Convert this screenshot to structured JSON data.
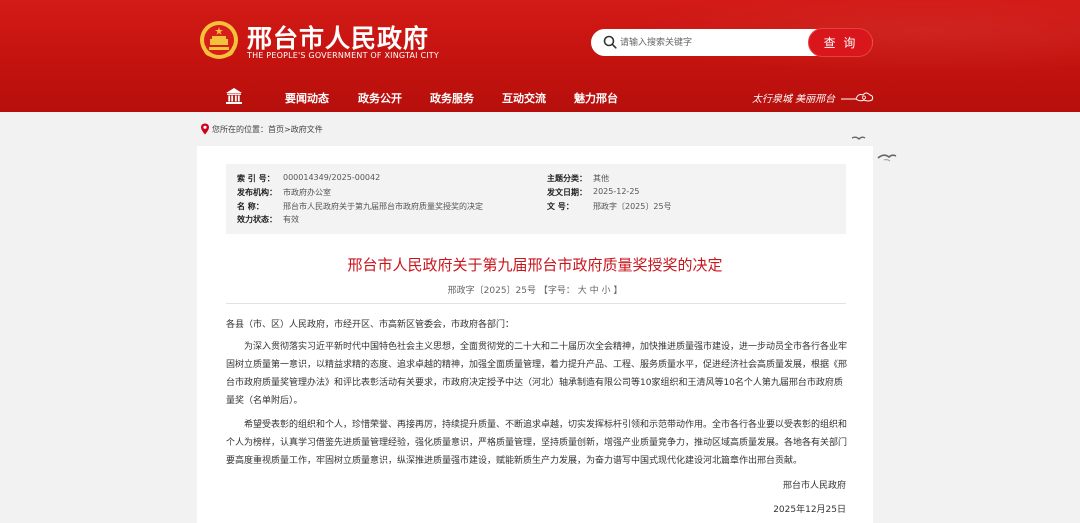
{
  "header": {
    "title": "邢台市人民政府",
    "subtitle": "THE PEOPLE'S GOVERNMENT OF XINGTAI CITY",
    "search_placeholder": "请输入搜索关键字",
    "search_button": "查 询",
    "slogan": "太行泉城 美丽邢台"
  },
  "nav": {
    "items": [
      "要闻动态",
      "政务公开",
      "政务服务",
      "互动交流",
      "魅力邢台"
    ]
  },
  "breadcrumb": {
    "prefix": "您所在的位置：",
    "path": "首页>政府文件"
  },
  "meta": {
    "index_label": "索 引 号：",
    "index_value": "000014349/2025-00042",
    "category_label": "主题分类：",
    "category_value": "其他",
    "org_label": "发布机构：",
    "org_value": "市政府办公室",
    "date_label": "发文日期：",
    "date_value": "2025-12-25",
    "name_label": "名 称：",
    "name_value": "邢台市人民政府关于第九届邢台市政府质量奖授奖的决定",
    "docno_label": "文 号：",
    "docno_value": "邢政字〔2025〕25号",
    "status_label": "效力状态：",
    "status_value": "有效"
  },
  "document": {
    "title": "邢台市人民政府关于第九届邢台市政府质量奖授奖的决定",
    "number_line": "邢政字〔2025〕25号 【字号： 大 中 小 】",
    "salutation": "各县（市、区）人民政府，市经开区、市高新区管委会，市政府各部门：",
    "para1": "为深入贯彻落实习近平新时代中国特色社会主义思想，全面贯彻党的二十大和二十届历次全会精神，加快推进质量强市建设，进一步动员全市各行各业牢固树立质量第一意识，以精益求精的态度、追求卓越的精神，加强全面质量管理，着力提升产品、工程、服务质量水平，促进经济社会高质量发展，根据《邢台市政府质量奖管理办法》和评比表彰活动有关要求，市政府决定授予中达（河北）轴承制造有限公司等10家组织和王清风等10名个人第九届邢台市政府质量奖（名单附后）。",
    "para2": "希望受表彰的组织和个人，珍惜荣誉、再接再厉，持续提升质量、不断追求卓越，切实发挥标杆引领和示范带动作用。全市各行各业要以受表彰的组织和个人为榜样，认真学习借鉴先进质量管理经验，强化质量意识，严格质量管理，坚持质量创新，增强产业质量竞争力，推动区域高质量发展。各地各有关部门要高度重视质量工作，牢固树立质量意识，纵深推进质量强市建设，赋能新质生产力发展，为奋力谱写中国式现代化建设河北篇章作出邢台贡献。",
    "signer": "邢台市人民政府",
    "sign_date": "2025年12月25日"
  }
}
